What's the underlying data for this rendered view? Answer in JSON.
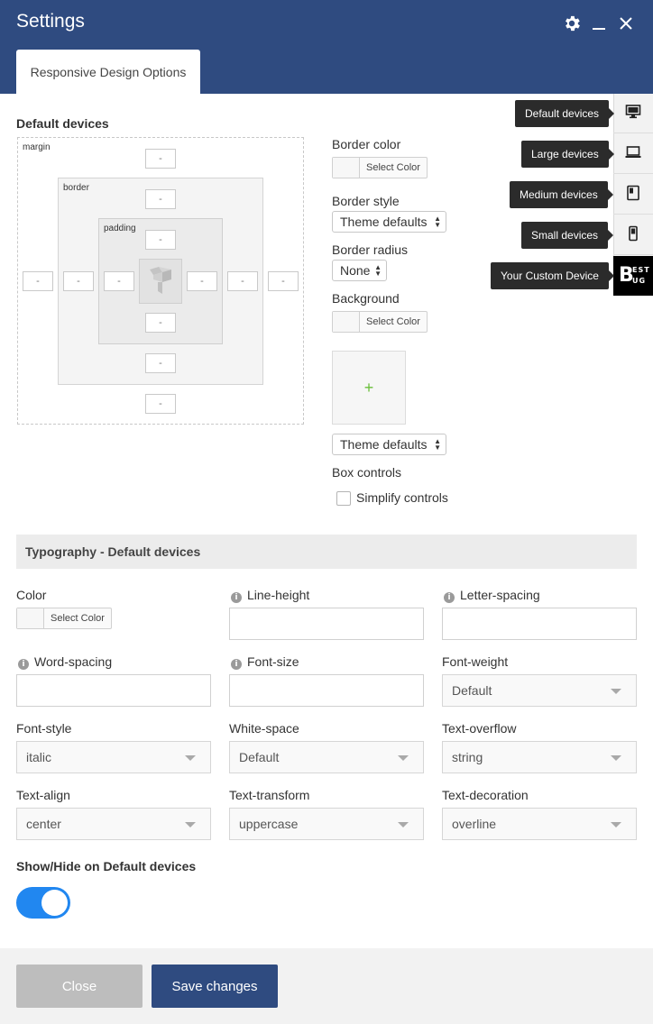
{
  "window": {
    "title": "Settings"
  },
  "tabs": [
    {
      "label": "Responsive Design Options",
      "active": true
    }
  ],
  "box_model": {
    "heading": "Default devices",
    "margin_label": "margin",
    "border_label": "border",
    "padding_label": "padding",
    "placeholder": "-"
  },
  "border_color": {
    "label": "Border color",
    "button": "Select Color"
  },
  "border_style": {
    "label": "Border style",
    "value": "Theme defaults"
  },
  "border_radius": {
    "label": "Border radius",
    "value": "None"
  },
  "background": {
    "label": "Background",
    "button": "Select Color",
    "image_add": "+",
    "size_value": "Theme defaults"
  },
  "box_controls": {
    "label": "Box controls",
    "checkbox_label": "Simplify controls",
    "checked": false
  },
  "devices": [
    {
      "label": "Default devices",
      "icon": "desktop-icon",
      "active": false
    },
    {
      "label": "Large devices",
      "icon": "laptop-icon",
      "active": false
    },
    {
      "label": "Medium devices",
      "icon": "tablet-icon",
      "active": false
    },
    {
      "label": "Small devices",
      "icon": "mobile-icon",
      "active": false
    },
    {
      "label": "Your Custom Device",
      "icon": "bestbug-logo-icon",
      "logo_big": "B",
      "logo_top": "EST",
      "logo_bottom": "UG",
      "active": true
    }
  ],
  "typography": {
    "heading": "Typography - Default devices",
    "color": {
      "label": "Color",
      "button": "Select Color"
    },
    "line_height": {
      "label": "Line-height",
      "value": ""
    },
    "letter_spacing": {
      "label": "Letter-spacing",
      "value": ""
    },
    "word_spacing": {
      "label": "Word-spacing",
      "value": ""
    },
    "font_size": {
      "label": "Font-size",
      "value": ""
    },
    "font_weight": {
      "label": "Font-weight",
      "value": "Default"
    },
    "font_style": {
      "label": "Font-style",
      "value": "italic"
    },
    "white_space": {
      "label": "White-space",
      "value": "Default"
    },
    "text_overflow": {
      "label": "Text-overflow",
      "value": "string"
    },
    "text_align": {
      "label": "Text-align",
      "value": "center"
    },
    "text_transform": {
      "label": "Text-transform",
      "value": "uppercase"
    },
    "text_decoration": {
      "label": "Text-decoration",
      "value": "overline"
    }
  },
  "show_hide": {
    "label": "Show/Hide on Default devices",
    "enabled": true
  },
  "footer": {
    "close_label": "Close",
    "save_label": "Save changes"
  },
  "colors": {
    "header_bg": "#2f4b80",
    "toggle_on": "#2187f0",
    "accent_plus": "#6abf3b"
  }
}
